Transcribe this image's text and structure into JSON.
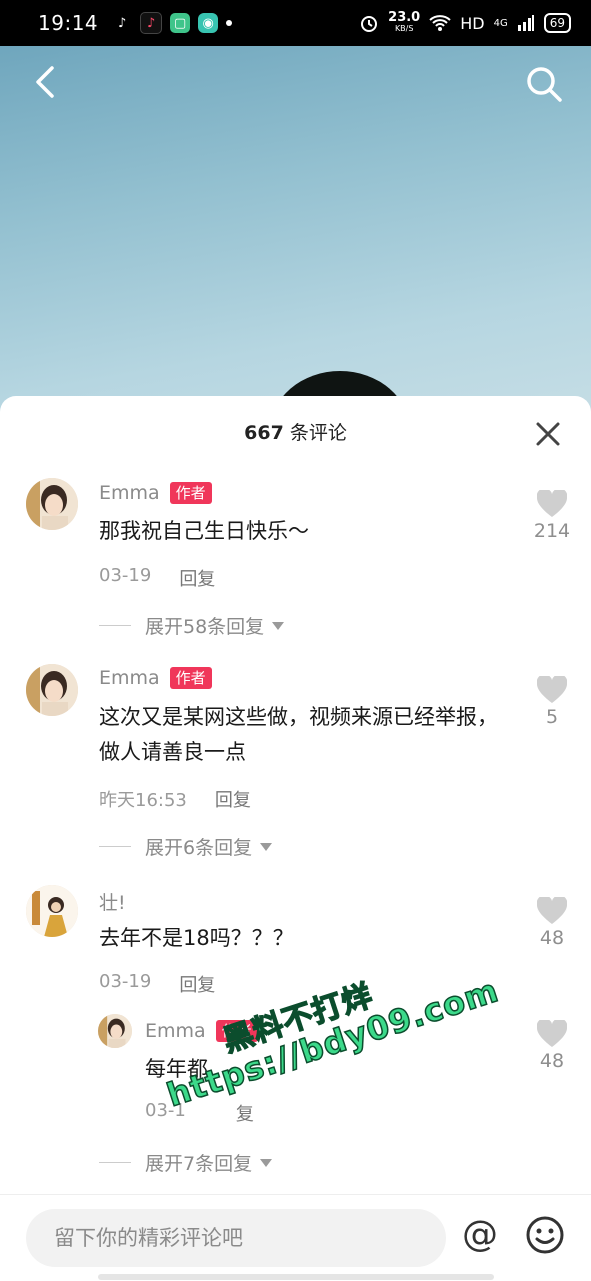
{
  "status_bar": {
    "time": "19:14",
    "net_speed_value": "23.0",
    "net_speed_unit": "KB/S",
    "hd_label": "HD",
    "network_label": "4G",
    "battery": "69"
  },
  "sheet": {
    "count": "667",
    "title_suffix": " 条评论"
  },
  "comments": [
    {
      "author": "Emma",
      "badge": "作者",
      "text": "那我祝自己生日快乐～",
      "date": "03-19",
      "reply_label": "回复",
      "likes": "214",
      "expand_label": "展开58条回复"
    },
    {
      "author": "Emma",
      "badge": "作者",
      "text": "这次又是某网这些做，视频来源已经举报，做人请善良一点",
      "date": "昨天16:53",
      "reply_label": "回复",
      "likes": "5",
      "expand_label": "展开6条回复"
    },
    {
      "author": "壮!",
      "text": "去年不是18吗？？？",
      "date": "03-19",
      "reply_label": "回复",
      "likes": "48"
    }
  ],
  "reply": {
    "author": "Emma",
    "badge": "作者",
    "text": "每年都",
    "date": "03-1",
    "reply_label": "复",
    "likes": "48",
    "expand_label": "展开7条回复"
  },
  "watermark": {
    "line1": "黑料不打烊",
    "line2": "https://bdy09.com"
  },
  "input": {
    "placeholder": "留下你的精彩评论吧",
    "at_symbol": "@"
  },
  "colors": {
    "badge": "#f0365a",
    "watermark": "#3cd98a"
  }
}
